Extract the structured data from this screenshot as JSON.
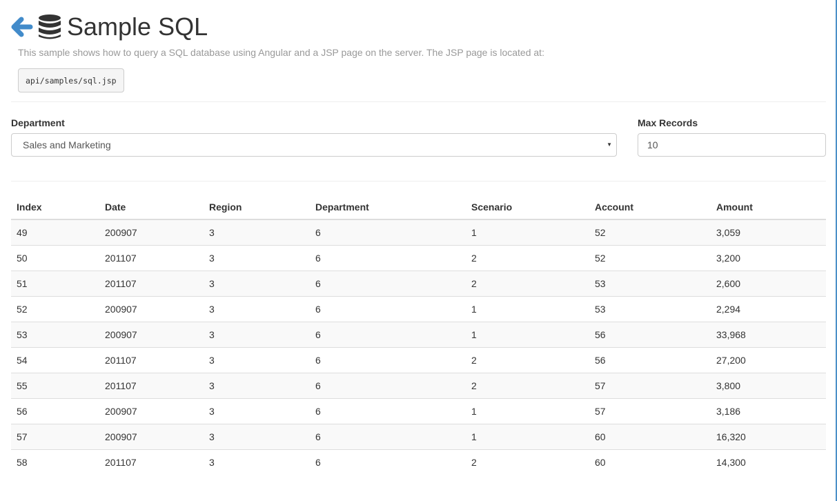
{
  "header": {
    "title": "Sample SQL",
    "back_icon": "arrow-left-icon",
    "title_icon": "database-icon",
    "accent_color": "#428bca"
  },
  "intro": {
    "description": "This sample shows how to query a SQL database using Angular and a JSP page on the server. The JSP page is located at:",
    "path": "api/samples/sql.jsp"
  },
  "filters": {
    "department_label": "Department",
    "department_value": "Sales and Marketing",
    "max_records_label": "Max Records",
    "max_records_value": "10"
  },
  "table": {
    "columns": [
      "Index",
      "Date",
      "Region",
      "Department",
      "Scenario",
      "Account",
      "Amount"
    ],
    "rows": [
      [
        "49",
        "200907",
        "3",
        "6",
        "1",
        "52",
        "3,059"
      ],
      [
        "50",
        "201107",
        "3",
        "6",
        "2",
        "52",
        "3,200"
      ],
      [
        "51",
        "201107",
        "3",
        "6",
        "2",
        "53",
        "2,600"
      ],
      [
        "52",
        "200907",
        "3",
        "6",
        "1",
        "53",
        "2,294"
      ],
      [
        "53",
        "200907",
        "3",
        "6",
        "1",
        "56",
        "33,968"
      ],
      [
        "54",
        "201107",
        "3",
        "6",
        "2",
        "56",
        "27,200"
      ],
      [
        "55",
        "201107",
        "3",
        "6",
        "2",
        "57",
        "3,800"
      ],
      [
        "56",
        "200907",
        "3",
        "6",
        "1",
        "57",
        "3,186"
      ],
      [
        "57",
        "200907",
        "3",
        "6",
        "1",
        "60",
        "16,320"
      ],
      [
        "58",
        "201107",
        "3",
        "6",
        "2",
        "60",
        "14,300"
      ]
    ]
  }
}
